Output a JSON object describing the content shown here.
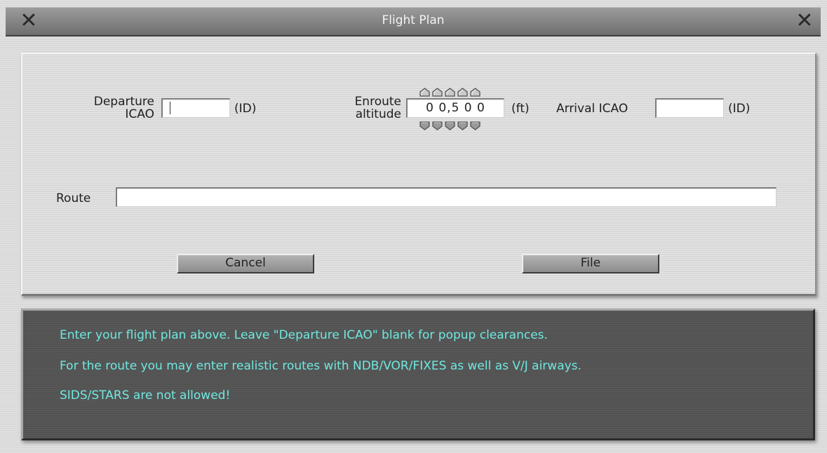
{
  "window": {
    "title": "Flight Plan",
    "close_left_icon": "close-x-icon",
    "close_right_icon": "close-x-icon",
    "close_glyph": "✕"
  },
  "form": {
    "departure": {
      "label_line1": "Departure",
      "label_line2": "ICAO",
      "value": "",
      "unit": "(ID)"
    },
    "altitude": {
      "label_line1": "Enroute",
      "label_line2": "altitude",
      "value": "0 0,5 0 0",
      "unit": "(ft)",
      "up_arrow_icon": "chevron-up-icon",
      "down_arrow_icon": "chevron-down-icon"
    },
    "arrival": {
      "label": "Arrival ICAO",
      "value": "",
      "unit": "(ID)"
    },
    "route": {
      "label": "Route",
      "value": ""
    }
  },
  "buttons": {
    "cancel": "Cancel",
    "file": "File"
  },
  "info": {
    "lines": [
      "Enter your flight plan above. Leave \"Departure ICAO\" blank for popup clearances.",
      "For the route you may enter realistic routes with NDB/VOR/FIXES as well as V/J airways.",
      "SIDS/STARS are not allowed!"
    ],
    "text_color": "#6fe8e0"
  }
}
